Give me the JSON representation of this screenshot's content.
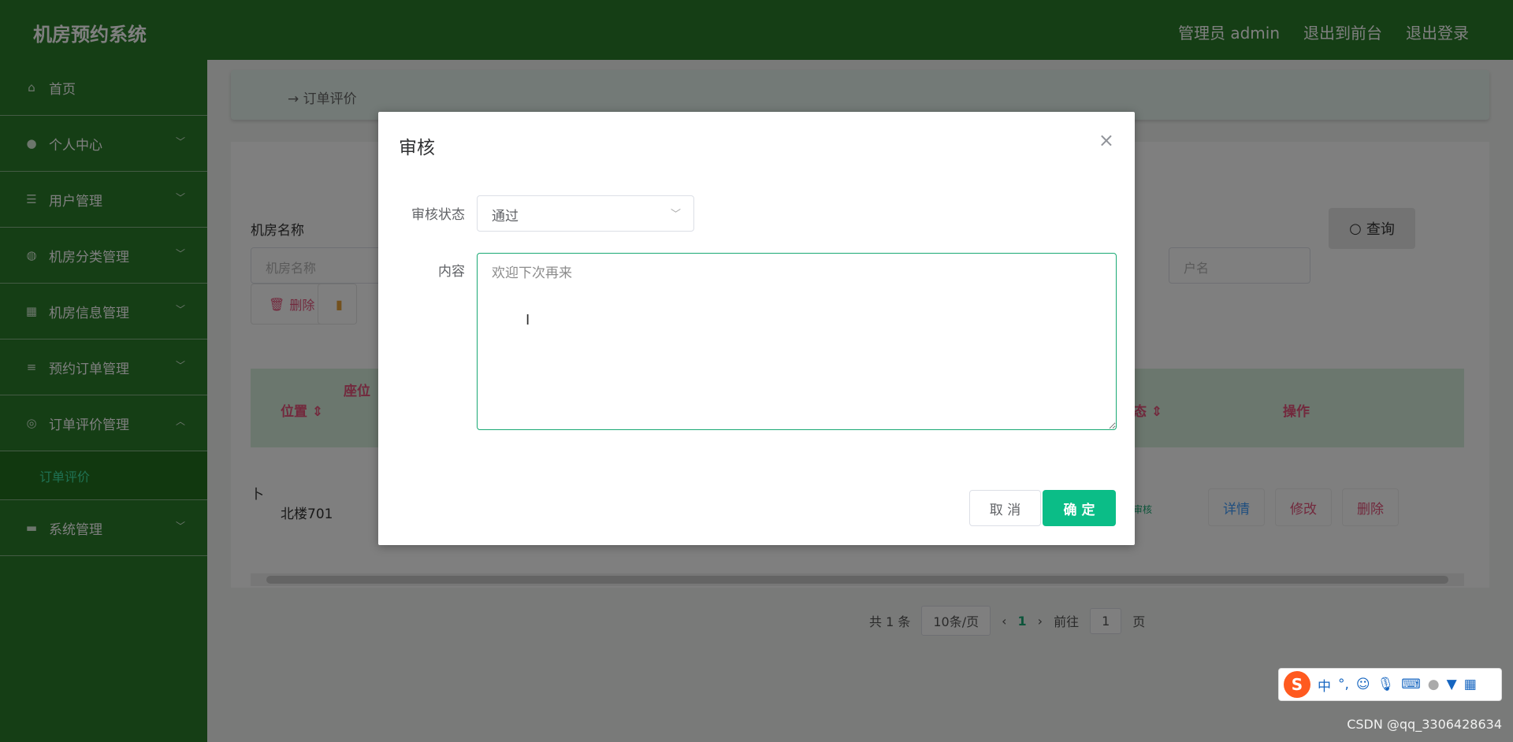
{
  "header": {
    "app_title": "机房预约系统",
    "admin_label": "管理员 admin",
    "exit_front": "退出到前台",
    "logout": "退出登录"
  },
  "sidebar": {
    "items": [
      {
        "label": "首页",
        "icon": "home-icon"
      },
      {
        "label": "个人中心",
        "icon": "user-icon"
      },
      {
        "label": "用户管理",
        "icon": "sliders-icon"
      },
      {
        "label": "机房分类管理",
        "icon": "globe-icon"
      },
      {
        "label": "机房信息管理",
        "icon": "grid-icon"
      },
      {
        "label": "预约订单管理",
        "icon": "list-icon"
      },
      {
        "label": "订单评价管理",
        "icon": "circle-icon"
      },
      {
        "label": "系统管理",
        "icon": "chat-icon"
      }
    ],
    "subitem": "订单评价"
  },
  "breadcrumb": {
    "text": "订单评价"
  },
  "search": {
    "label": "机房名称",
    "placeholder": "机房名称",
    "right_placeholder": "户名",
    "query_button": "查询"
  },
  "toolbar": {
    "delete_label": "删除"
  },
  "table": {
    "headers": {
      "location": "位置",
      "seat": "座位",
      "status": "态",
      "operation": "操作"
    },
    "row": {
      "location": "北楼701",
      "left_fragment": "卜",
      "status": "审核",
      "detail": "详情",
      "edit": "修改",
      "delete": "删除"
    }
  },
  "pager": {
    "total": "共 1 条",
    "per_page": "10条/页",
    "current": "1",
    "goto_prefix": "前往",
    "goto_value": "1",
    "goto_suffix": "页"
  },
  "dialog": {
    "title": "审核",
    "status_label": "审核状态",
    "status_value": "通过",
    "content_label": "内容",
    "content_value": "欢迎下次再来",
    "cancel": "取 消",
    "confirm": "确 定"
  },
  "ime": {
    "mode": "中",
    "punct": "°,"
  },
  "watermark": "CSDN @qq_3306428634"
}
